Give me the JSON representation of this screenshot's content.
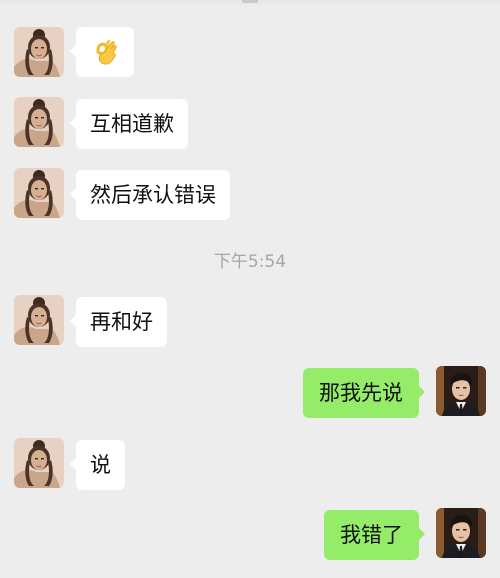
{
  "chat": {
    "timestamp": "下午5:54",
    "messages": [
      {
        "side": "left",
        "emoji": "ok-hand-icon"
      },
      {
        "side": "left",
        "text": "互相道歉"
      },
      {
        "side": "left",
        "text": "然后承认错误"
      },
      {
        "side": "left",
        "text": "再和好"
      },
      {
        "side": "right",
        "text": "那我先说"
      },
      {
        "side": "left",
        "text": "说"
      },
      {
        "side": "right",
        "text": "我错了"
      }
    ]
  },
  "colors": {
    "background": "#ededed",
    "incoming_bubble": "#ffffff",
    "outgoing_bubble": "#95ec69",
    "timestamp_text": "#a6a6a6"
  }
}
